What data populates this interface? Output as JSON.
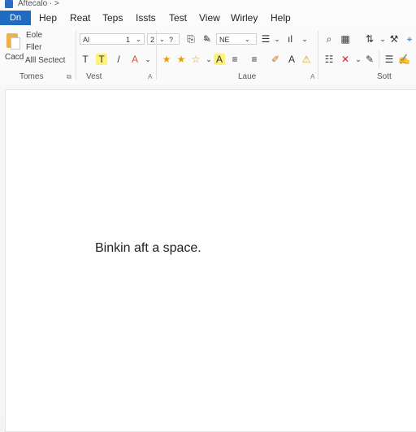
{
  "title_bar": {
    "title": "Aftecalo  ·  >"
  },
  "menu": {
    "file_tab": "Dn",
    "items": [
      "Hep",
      "Reat",
      "Teps",
      "Issts",
      "Test",
      "View",
      "Wirley",
      "Help"
    ]
  },
  "ribbon": {
    "clipboard": {
      "label_1": "Eole",
      "label_2": "Fller",
      "label_3": "Cacd",
      "label_4": "Alll Sectect"
    },
    "font": {
      "name": "Al",
      "size_1": "1",
      "size_2": "2"
    },
    "style_box": "NE",
    "group_labels": [
      "Tomes",
      "Vest",
      "Laue",
      "Sott"
    ]
  },
  "document": {
    "text": "Binkin aft a space."
  },
  "colors": {
    "accent": "#1f6bc1",
    "highlight": "#fff27a",
    "warning": "#e0a000",
    "delete": "#d02020"
  }
}
